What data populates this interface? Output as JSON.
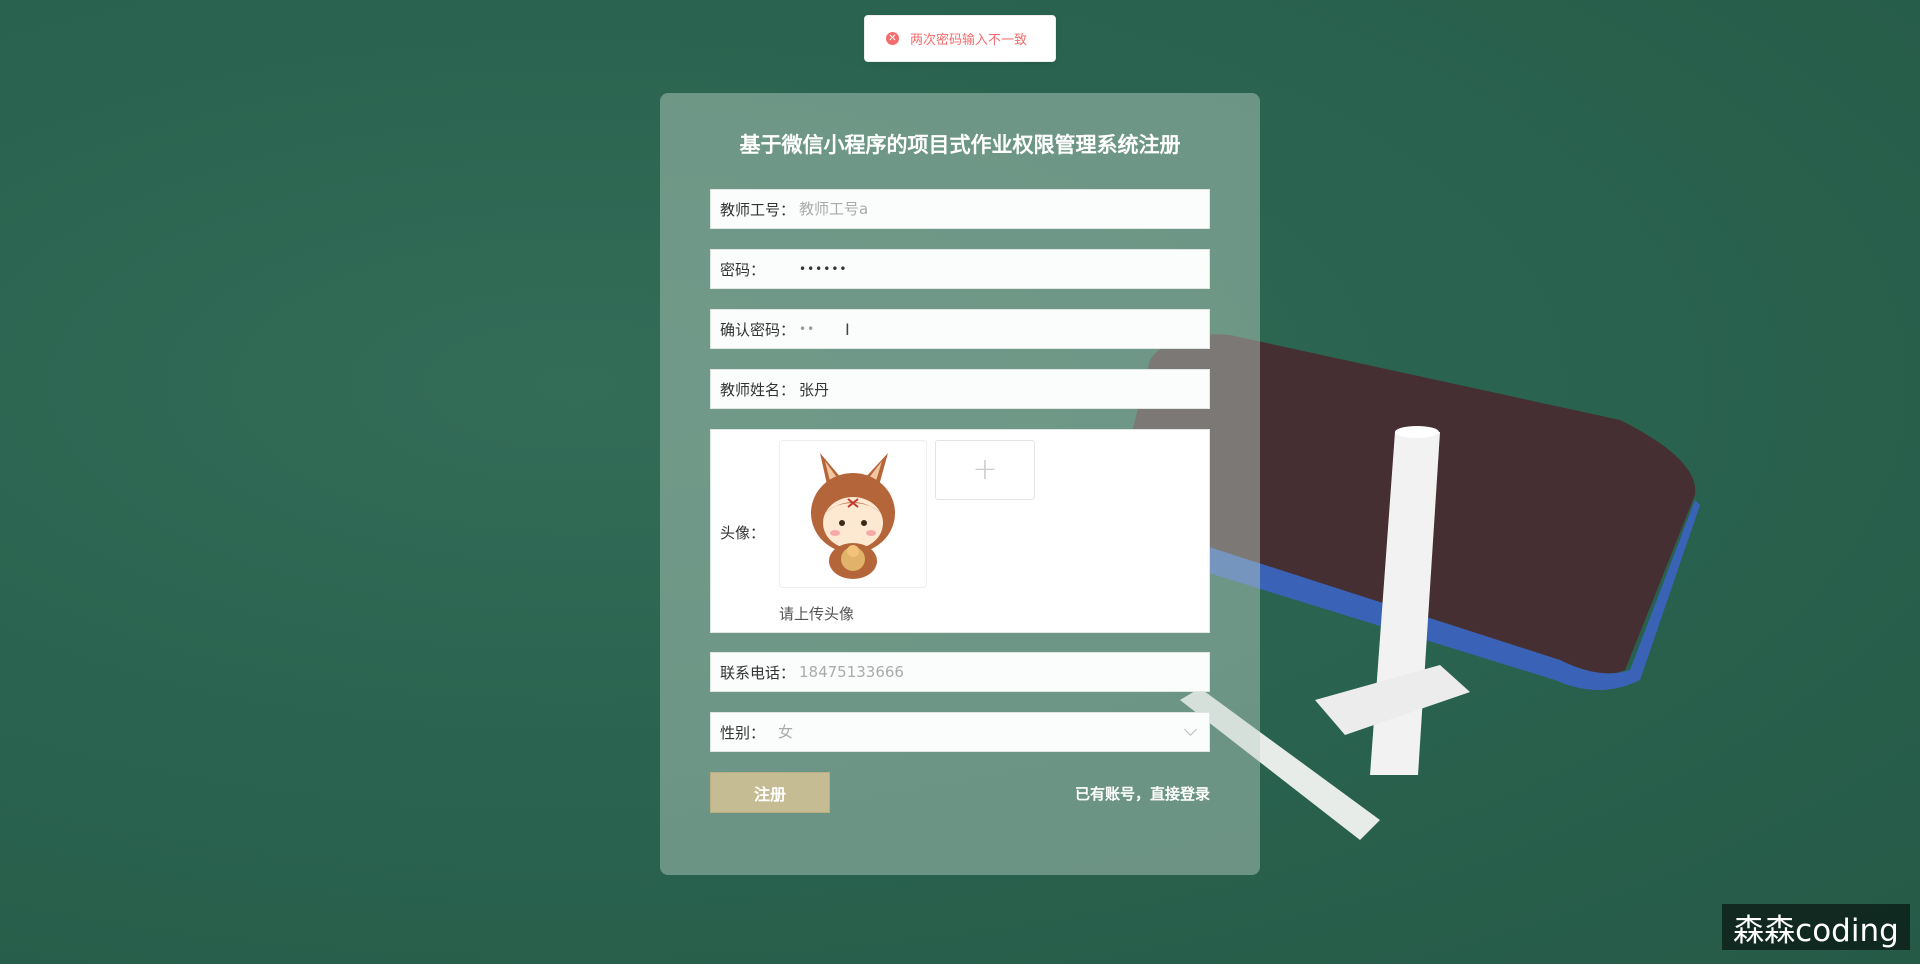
{
  "toast": {
    "icon": "error-circle-icon",
    "message": "两次密码输入不一致",
    "color": "#f56c6c"
  },
  "form": {
    "title": "基于微信小程序的项目式作业权限管理系统注册",
    "fields": {
      "teacher_id": {
        "label": "教师工号：",
        "placeholder": "教师工号a",
        "value": ""
      },
      "password": {
        "label": "密码：",
        "value": "••••••"
      },
      "confirm_password": {
        "label": "确认密码：",
        "value": "••"
      },
      "teacher_name": {
        "label": "教师姓名：",
        "value": "张丹"
      },
      "avatar": {
        "label": "头像：",
        "hint": "请上传头像",
        "upload_icon": "plus-icon",
        "image": "cartoon-donkey-avatar"
      },
      "phone": {
        "label": "联系电话：",
        "placeholder": "18475133666",
        "value": ""
      },
      "gender": {
        "label": "性别：",
        "placeholder": "女"
      }
    },
    "register_button": "注册",
    "login_link": "已有账号，直接登录"
  },
  "colors": {
    "background": "#2a6450",
    "button": "#c5bc93"
  },
  "watermark": "森森coding"
}
